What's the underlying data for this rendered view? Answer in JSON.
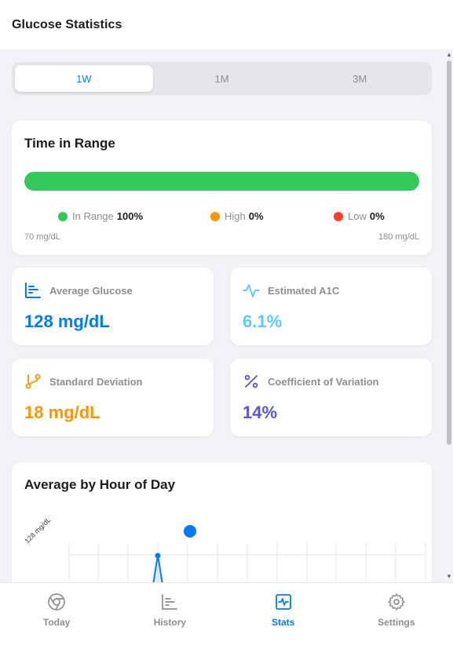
{
  "header": {
    "title": "Glucose Statistics"
  },
  "period_selector": {
    "options": [
      "1W",
      "1M",
      "3M"
    ],
    "selected": "1W"
  },
  "time_in_range": {
    "title": "Time in Range",
    "in_range_pct": 100,
    "high_pct": 0,
    "low_pct": 0,
    "legend": [
      {
        "label": "In Range",
        "value": "100%",
        "color": "#34c759"
      },
      {
        "label": "High",
        "value": "0%",
        "color": "#ff9500"
      },
      {
        "label": "Low",
        "value": "0%",
        "color": "#ff3b30"
      }
    ],
    "range_min": "70 mg/dL",
    "range_max": "180 mg/dL"
  },
  "stats": [
    {
      "label": "Average Glucose",
      "value": "128 mg/dL",
      "color": "#007aff",
      "icon": "bar-chart-icon"
    },
    {
      "label": "Estimated A1C",
      "value": "6.1%",
      "color": "#5ac8fa",
      "icon": "pulse-icon"
    },
    {
      "label": "Standard Deviation",
      "value": "18 mg/dL",
      "color": "#ff9500",
      "icon": "branch-icon"
    },
    {
      "label": "Coefficient of Variation",
      "value": "14%",
      "color": "#5856d6",
      "icon": "percent-icon"
    }
  ],
  "hourly": {
    "title": "Average by Hour of Day",
    "y_tick_label": "128 mg/dL"
  },
  "chart_data": {
    "type": "line",
    "title": "Average by Hour of Day",
    "y_tick_labels": [
      "128 mg/dL"
    ],
    "series": [
      {
        "values": [
          128
        ]
      }
    ],
    "grid": true
  },
  "tabs": [
    {
      "label": "Today",
      "icon": "chrome-icon"
    },
    {
      "label": "History",
      "icon": "history-chart-icon"
    },
    {
      "label": "Stats",
      "icon": "activity-square-icon",
      "active": true
    },
    {
      "label": "Settings",
      "icon": "gear-icon"
    }
  ],
  "colors": {
    "accent": "#007aff",
    "background": "#f2f2f7"
  }
}
